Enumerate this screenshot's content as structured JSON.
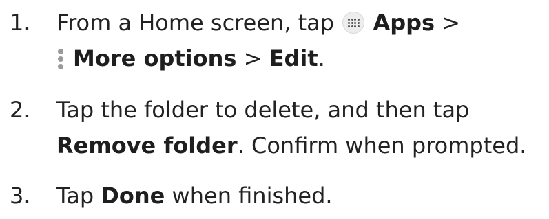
{
  "steps": [
    {
      "number": "1.",
      "line1_prefix": "From a Home screen, tap ",
      "apps_label": "Apps",
      "sep1": " >",
      "more_options_label": "More options",
      "sep2": " > ",
      "edit_label": "Edit",
      "end": ".",
      "icons": [
        "apps-grid-icon",
        "more-options-icon"
      ]
    },
    {
      "number": "2.",
      "line1": "Tap the folder to delete, and then tap",
      "remove_folder_label": "Remove folder",
      "line2_suffix": ". Confirm when prompted."
    },
    {
      "number": "3.",
      "prefix": "Tap ",
      "done_label": "Done",
      "suffix": " when finished."
    }
  ]
}
